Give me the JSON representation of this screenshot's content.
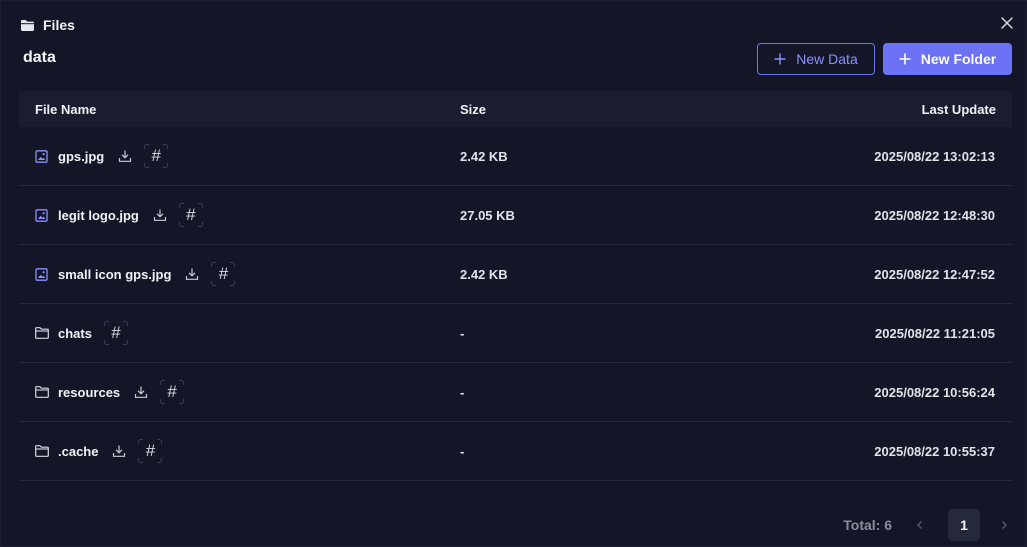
{
  "window": {
    "title": "Files"
  },
  "path": {
    "title": "data"
  },
  "toolbar": {
    "new_data_label": "New Data",
    "new_folder_label": "New Folder"
  },
  "table": {
    "columns": {
      "name": "File Name",
      "size": "Size",
      "updated": "Last Update"
    },
    "rows": [
      {
        "name": "gps.jpg",
        "type": "image",
        "size": "2.42 KB",
        "updated": "2025/08/22 13:02:13",
        "downloadable": true
      },
      {
        "name": "legit logo.jpg",
        "type": "image",
        "size": "27.05 KB",
        "updated": "2025/08/22 12:48:30",
        "downloadable": true
      },
      {
        "name": "small icon gps.jpg",
        "type": "image",
        "size": "2.42 KB",
        "updated": "2025/08/22 12:47:52",
        "downloadable": true
      },
      {
        "name": "chats",
        "type": "folder",
        "size": "-",
        "updated": "2025/08/22 11:21:05",
        "downloadable": false
      },
      {
        "name": "resources",
        "type": "folder",
        "size": "-",
        "updated": "2025/08/22 10:56:24",
        "downloadable": true
      },
      {
        "name": ".cache",
        "type": "folder",
        "size": "-",
        "updated": "2025/08/22 10:55:37",
        "downloadable": true
      }
    ]
  },
  "pagination": {
    "total_label": "Total: 6",
    "current_page": "1"
  },
  "icons": {
    "window": "folder-icon",
    "close": "close-icon",
    "add": "plus-icon",
    "image_file": "image-file-icon",
    "folder": "folder-icon",
    "download": "download-icon",
    "hash": "hash-icon",
    "prev": "chevron-left-icon",
    "next": "chevron-right-icon"
  },
  "colors": {
    "accent": "#6c72f6",
    "background": "#141526",
    "header": "#1b1c2f",
    "file_icon": "#8b92ff"
  }
}
